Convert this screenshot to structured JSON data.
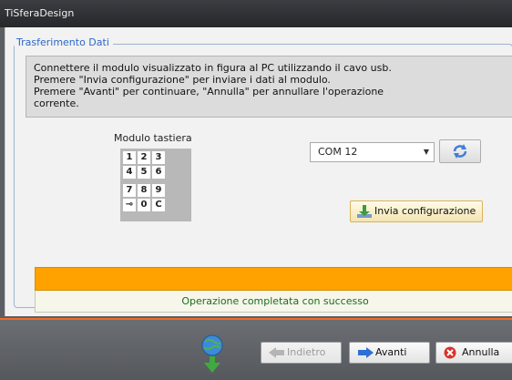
{
  "window": {
    "title": "TiSferaDesign"
  },
  "group": {
    "title": "Trasferimento Dati"
  },
  "info": {
    "lines": [
      "Connettere il modulo visualizzato in figura al PC utilizzando il cavo usb.",
      "Premere \"Invia configurazione\" per inviare i dati al modulo.",
      "Premere \"Avanti\" per continuare, \"Annulla\" per annullare l'operazione",
      "corrente."
    ]
  },
  "module": {
    "title": "Modulo tastiera",
    "keys": [
      "1",
      "2",
      "3",
      "4",
      "5",
      "6",
      "7",
      "8",
      "9",
      "⊸",
      "0",
      "C"
    ]
  },
  "port": {
    "selected": "COM 12"
  },
  "send_button": {
    "label": "Invia configurazione"
  },
  "progress": {
    "fraction": 1.0,
    "color": "#ffa200"
  },
  "status": {
    "text": "Operazione completata con successo"
  },
  "footer": {
    "back_label": "Indietro",
    "next_label": "Avanti",
    "cancel_label": "Annulla"
  },
  "colors": {
    "accent": "#ef6a2b",
    "group_title": "#2c67c8",
    "status_text": "#1e6b1e",
    "cancel_icon": "#d9322c",
    "next_icon": "#2f6fd6"
  },
  "icons": {
    "refresh": "refresh-icon",
    "send": "download-arrow-icon",
    "globe": "globe-download-icon",
    "back": "arrow-left-icon",
    "next": "arrow-right-icon",
    "cancel": "cancel-icon"
  }
}
